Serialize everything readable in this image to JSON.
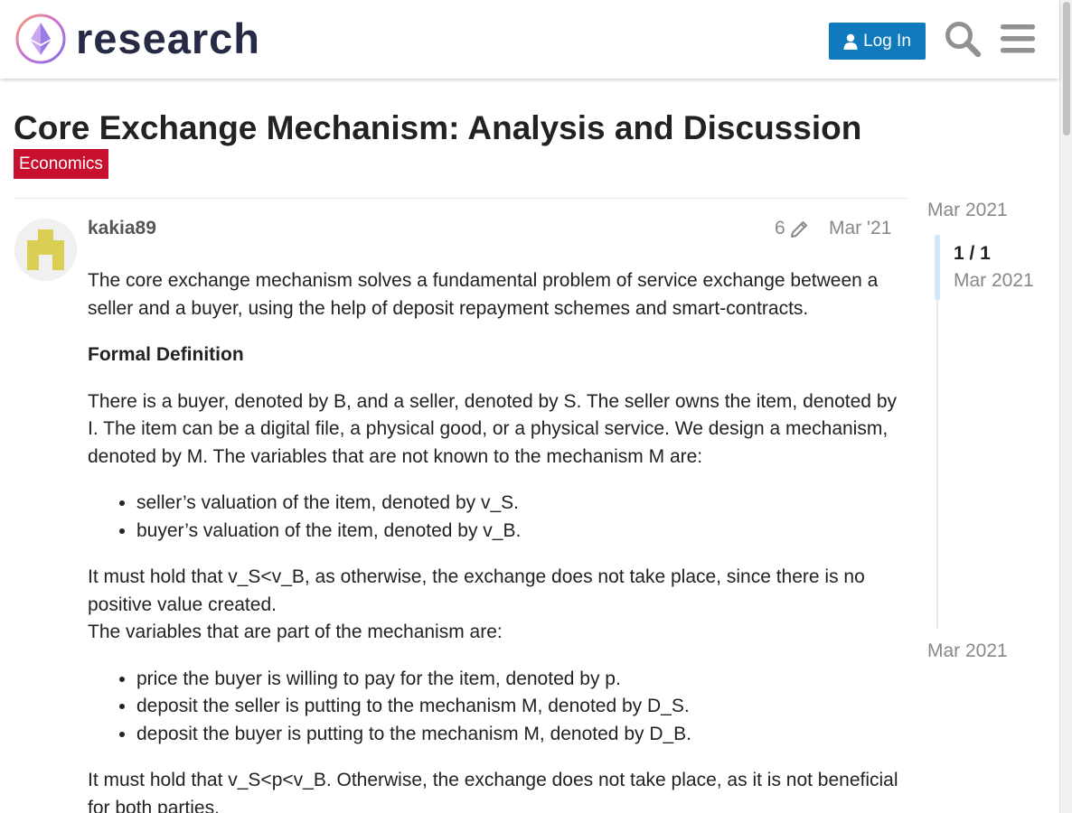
{
  "header": {
    "site_name": "research",
    "login_label": "Log In"
  },
  "topic": {
    "title": "Core Exchange Mechanism: Analysis and Discussion",
    "category": "Economics"
  },
  "post": {
    "username": "kakia89",
    "edit_count": "6",
    "date": "Mar '21",
    "p1": "The core exchange mechanism solves a fundamental problem of service exchange between a seller and a buyer, using the help of deposit repayment schemes and smart-contracts.",
    "heading": "Formal Definition",
    "p2": "There is a buyer, denoted by B, and a seller, denoted by S. The seller owns the item, denoted by I. The item can be a digital file, a physical good, or a physical service. We design a mechanism, denoted by M. The variables that are not known to the mechanism M are:",
    "list1": [
      "seller’s valuation of the item, denoted by v_S.",
      "buyer’s valuation of the item, denoted by v_B."
    ],
    "p3": "It must hold that v_S<v_B, as otherwise, the exchange does not take place, since there is no positive value created.",
    "p4": "The variables that are part of the mechanism are:",
    "list2": [
      "price the buyer is willing to pay for the item, denoted by p.",
      "deposit the seller is putting to the mechanism M, denoted by D_S.",
      "deposit the buyer is putting to the mechanism M, denoted by D_B."
    ],
    "p5": "It must hold that v_S<p<v_B. Otherwise, the exchange does not take place, as it is not beneficial for both parties."
  },
  "timeline": {
    "start": "Mar 2021",
    "count": "1 / 1",
    "current": "Mar 2021",
    "end": "Mar 2021"
  },
  "colors": {
    "accent": "#0f7bbd",
    "category": "#c8102e"
  }
}
